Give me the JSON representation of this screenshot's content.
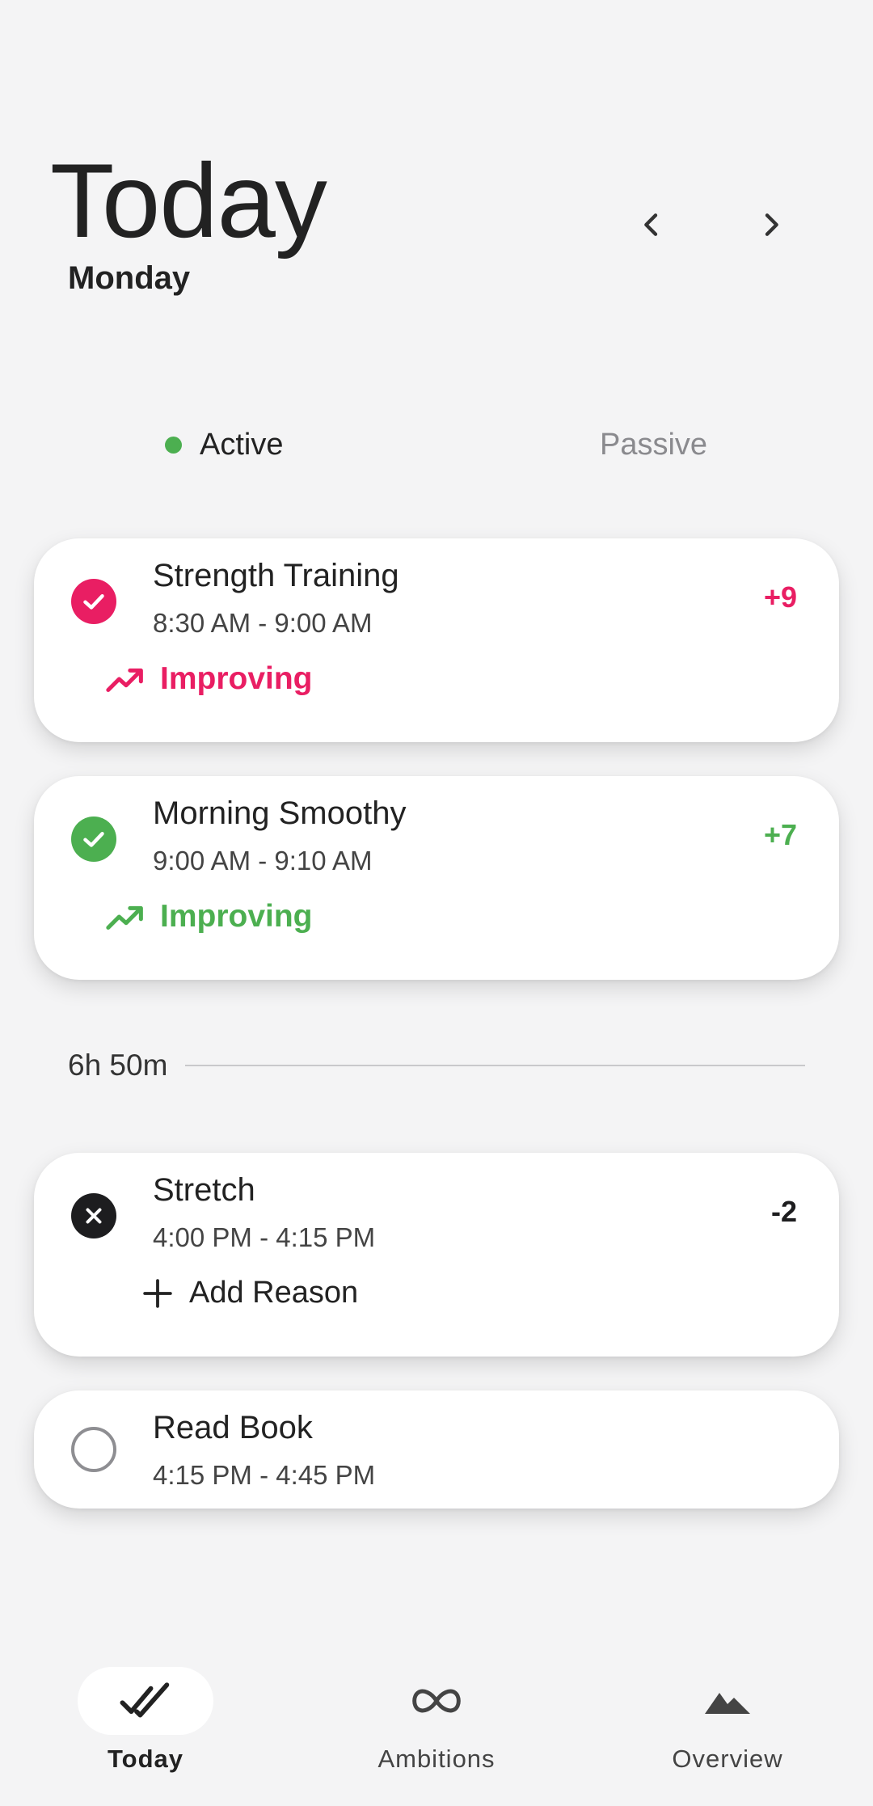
{
  "header": {
    "title": "Today",
    "subtitle": "Monday"
  },
  "segments": {
    "active": "Active",
    "passive": "Passive",
    "selected": "active"
  },
  "colors": {
    "pink": "#e91e63",
    "green": "#4caf50",
    "dark": "#1d1d1f",
    "muted": "#8a8a8e"
  },
  "habits": [
    {
      "name": "Strength Training",
      "time": "8:30 AM - 9:00 AM",
      "score": "+9",
      "status": "done",
      "trend": "Improving",
      "icon": "check-circle-icon"
    },
    {
      "name": "Morning Smoothy",
      "time": "9:00 AM - 9:10 AM",
      "score": "+7",
      "status": "done",
      "trend": "Improving",
      "icon": "check-circle-icon"
    },
    {
      "name": "Stretch",
      "time": "4:00 PM - 4:15 PM",
      "score": "-2",
      "status": "missed",
      "action": "Add Reason",
      "icon": "x-circle-icon"
    },
    {
      "name": "Read Book",
      "time": "4:15 PM - 4:45 PM",
      "status": "pending",
      "icon": "empty-circle-icon"
    }
  ],
  "gap": {
    "label": "6h 50m"
  },
  "bottom_nav": [
    {
      "label": "Today",
      "icon": "double-check-icon",
      "selected": true
    },
    {
      "label": "Ambitions",
      "icon": "infinity-icon",
      "selected": false
    },
    {
      "label": "Overview",
      "icon": "mountain-icon",
      "selected": false
    }
  ]
}
